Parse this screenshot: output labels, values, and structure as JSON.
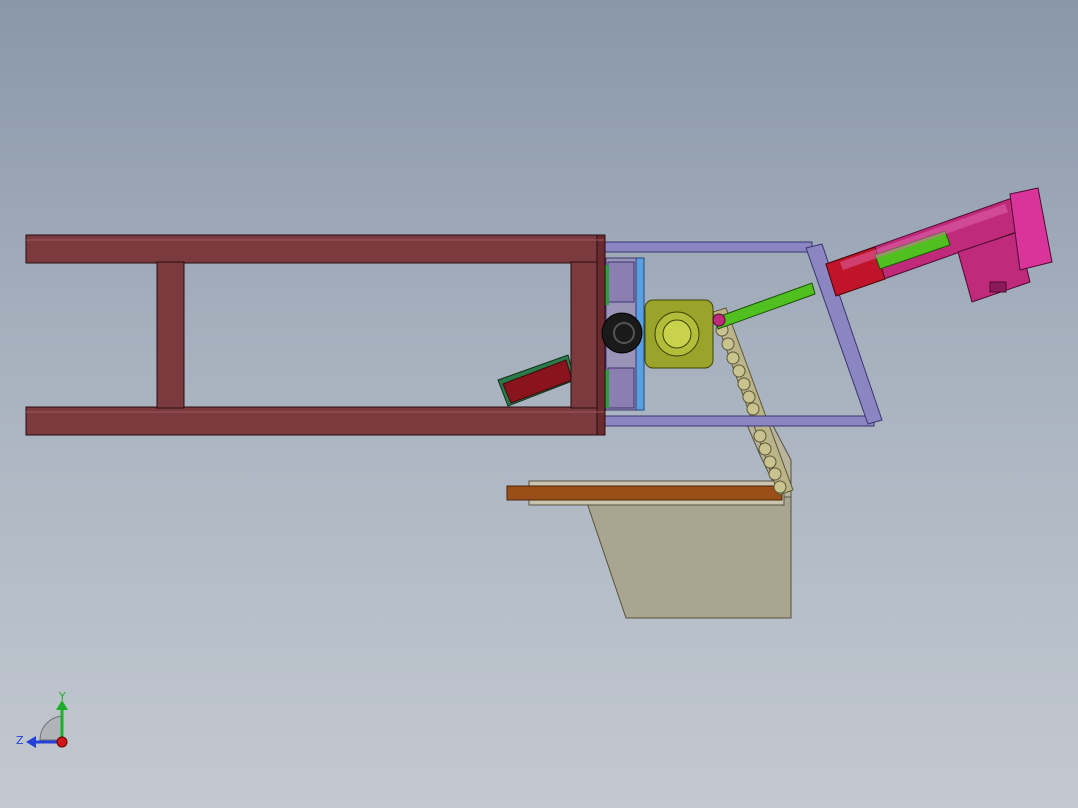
{
  "viewport": {
    "name": "cad-graphics-area",
    "background_top": "#8997aa",
    "background_bottom": "#c3c9d0"
  },
  "triad": {
    "y_label": "Y",
    "z_label": "Z",
    "y_color": "#1fae2a",
    "z_color": "#2340d8",
    "x_color": "#d01818"
  },
  "colors": {
    "frame_rail": "#7a3a3e",
    "frame_rail_dark": "#4e1f22",
    "sub_frame": "#8b85c2",
    "cylinder_body": "#c02a7a",
    "cylinder_rod": "#4fc020",
    "cylinder_red": "#c0142a",
    "hub": "#9aa42a",
    "roller": "#c9c390",
    "chute": "#a9a58f",
    "chute_bar": "#9a4e18",
    "blue_block": "#5aa0e0",
    "guide_block": "#8a7fb0"
  }
}
